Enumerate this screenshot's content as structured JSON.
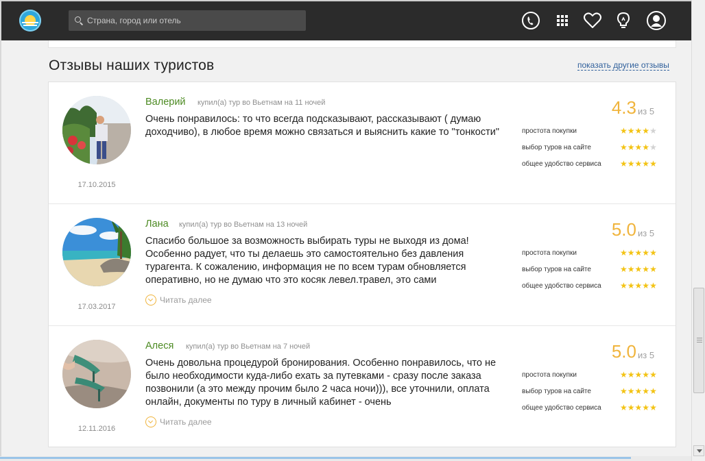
{
  "header": {
    "search_placeholder": "Страна, город или отель",
    "icons": [
      "phone-icon",
      "apps-grid-icon",
      "heart-icon",
      "bulb-icon",
      "profile-icon"
    ]
  },
  "section": {
    "title": "Отзывы наших туристов",
    "show_more": "показать другие отзывы"
  },
  "labels": {
    "of_five": "из 5",
    "read_more": "Читать далее",
    "criteria": [
      "простота покупки",
      "выбор туров на сайте",
      "общее удобство сервиса"
    ]
  },
  "reviews": [
    {
      "author": "Валерий",
      "tour": "купил(а) тур во Вьетнам на 11 ночей",
      "text": "Очень понравилось: то что всегда подсказывают, рассказывают ( думаю доходчиво), в любое время можно связаться и выяснить какие то \"тонкости\"",
      "date": "17.10.2015",
      "score": "4.3",
      "ratings": [
        4,
        4,
        5
      ],
      "read_more": false
    },
    {
      "author": "Лана",
      "tour": "купил(а) тур во Вьетнам на 13 ночей",
      "text": "Спасибо большое за возможность выбирать туры не выходя из дома! Особенно радует, что ты делаешь это самостоятельно без давления турагента. К сожалению, информация не по всем турам обновляется оперативно, но не думаю что это косяк левел.травел, это сами",
      "date": "17.03.2017",
      "score": "5.0",
      "ratings": [
        5,
        5,
        5
      ],
      "read_more": true
    },
    {
      "author": "Алеся",
      "tour": "купил(а) тур во Вьетнам на 7 ночей",
      "text": "Очень довольна процедурой бронирования. Особенно понравилось, что не было необходимости куда-либо ехать за путевками - сразу после заказа позвонили (а это между прочим было 2 часа ночи))), все уточнили, оплата онлайн, документы по туру в личный кабинет - очень",
      "date": "12.11.2016",
      "score": "5.0",
      "ratings": [
        5,
        5,
        5
      ],
      "read_more": true
    }
  ],
  "colors": {
    "accent": "#f0b43c",
    "author": "#4c8a22",
    "link": "#2f5f9b",
    "header_bg": "#2b2b2b"
  }
}
